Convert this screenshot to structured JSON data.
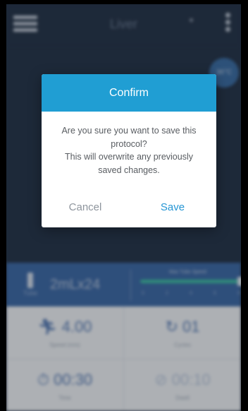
{
  "header": {
    "title": "Liver",
    "temp_badge": "36°C"
  },
  "speed_panel": {
    "tube_label": "Tube",
    "volume": "2mLx24",
    "slider_label": "Max Tube Speed",
    "ticks": [
      "0",
      "2",
      "4",
      "6",
      "8"
    ],
    "slider_level": 1.0
  },
  "stats": {
    "speed_value": "4.00",
    "speed_label": "Speed (m/s)",
    "cycles_value": "01",
    "cycles_label": "Cycles",
    "time_value": "00:30",
    "time_label": "Time",
    "dwell_value": "00:10",
    "dwell_label": "Dwell"
  },
  "dialog": {
    "title": "Confirm",
    "message_line1": "Are you sure you want to save this",
    "message_line2": "protocol?",
    "message_line3": "This will overwrite any previously",
    "message_line4": "saved changes.",
    "cancel_label": "Cancel",
    "save_label": "Save"
  },
  "colors": {
    "accent": "#209ED3",
    "background": "#233042",
    "panel": "#3D6AA8",
    "slider": "#3FC9A7"
  }
}
